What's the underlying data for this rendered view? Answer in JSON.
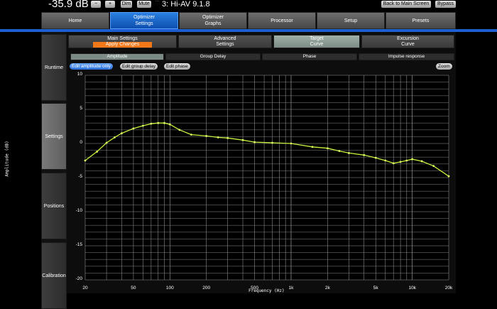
{
  "topbar": {
    "volume": "-35.9 dB",
    "minus": "−",
    "plus": "+",
    "dim": "Dim",
    "mute": "Mute",
    "signal": "···",
    "preset": "3: Hi-AV 9.1.8",
    "back": "Back to Main Screen",
    "bypass": "Bypass"
  },
  "main_tabs": [
    {
      "label": "Home"
    },
    {
      "label": "Optimizer Settings"
    },
    {
      "label": "Optimizer Graphs"
    },
    {
      "label": "Processor"
    },
    {
      "label": "Setup"
    },
    {
      "label": "Presets"
    }
  ],
  "side_tabs": [
    {
      "label": "Runtime"
    },
    {
      "label": "Settings"
    },
    {
      "label": "Positions"
    },
    {
      "label": "Calibration"
    }
  ],
  "sub_tabs": {
    "main_settings": "Main Settings",
    "apply": "Apply Changes",
    "advanced": "Advanced Settings",
    "target": "Target Curve",
    "excursion": "Excursion Curve"
  },
  "view_tabs": [
    "Amplitude",
    "Group Delay",
    "Phase",
    "Impulse response"
  ],
  "edit_buttons": {
    "amp": "Edit amplitude only",
    "gd": "Edit group delay",
    "phase": "Edit phase",
    "zoom": "Zoom"
  },
  "colors": {
    "accent": "#1d5fd0",
    "curve": "#c8f03c",
    "point": "#d8ff60",
    "orange": "#f07818"
  },
  "chart_data": {
    "type": "line",
    "xscale": "log",
    "xlim": [
      20,
      20000
    ],
    "ylim": [
      -20,
      10
    ],
    "ylabel": "Amplitude (dB)",
    "xlabel": "Frequency (Hz)",
    "x_ticks": [
      "20",
      "50",
      "100",
      "200",
      "500",
      "1k",
      "2k",
      "5k",
      "10k",
      "20k"
    ],
    "y_ticks": [
      "10",
      "5",
      "0",
      "-5",
      "-10",
      "-15",
      "-20"
    ],
    "grid": true,
    "series": [
      {
        "x": [
          20,
          25,
          30,
          35,
          40,
          50,
          60,
          70,
          80,
          90,
          100,
          120,
          150,
          200,
          250,
          300,
          400,
          500,
          700,
          1000,
          1500,
          2000,
          2500,
          3000,
          4000,
          5000,
          6000,
          7000,
          8000,
          9000,
          10000,
          12000,
          15000,
          20000
        ],
        "y": [
          -2.5,
          -1.2,
          0.1,
          0.9,
          1.5,
          2.2,
          2.6,
          2.9,
          3.0,
          3.0,
          2.8,
          2.0,
          1.3,
          1.1,
          0.9,
          0.8,
          0.5,
          0.2,
          0.1,
          0.0,
          -0.5,
          -0.7,
          -1.1,
          -1.4,
          -1.7,
          -2.1,
          -2.5,
          -2.9,
          -2.7,
          -2.5,
          -2.3,
          -2.6,
          -3.3,
          -4.8
        ]
      }
    ]
  }
}
